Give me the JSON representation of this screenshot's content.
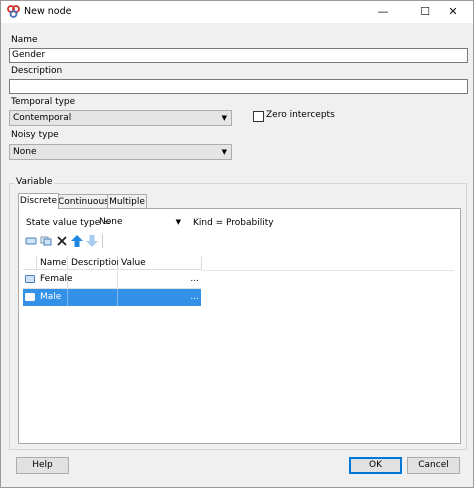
{
  "window": {
    "title": "New node",
    "minimize_glyph": "—",
    "maximize_glyph": "☐",
    "close_glyph": "✕"
  },
  "form": {
    "name_label": "Name",
    "name_value": "Gender",
    "description_label": "Description",
    "description_value": "",
    "temporal_label": "Temporal type",
    "temporal_value": "Contemporal",
    "zero_intercepts_label": "Zero intercepts",
    "zero_intercepts_checked": false,
    "noisy_label": "Noisy type",
    "noisy_value": "None"
  },
  "variable": {
    "group_label": "Variable",
    "tabs": [
      {
        "label": "Discrete",
        "active": true
      },
      {
        "label": "Continuous",
        "active": false
      },
      {
        "label": "Multiple",
        "active": false
      }
    ],
    "state_value_type_label": "State value type =",
    "state_value_type_value": "None",
    "kind_label": "Kind =",
    "kind_value": "Probability",
    "toolbar_icons": [
      "add-state-icon",
      "copy-state-icon",
      "delete-icon",
      "move-up-icon",
      "move-down-icon"
    ],
    "grid": {
      "columns": [
        "Name",
        "Description",
        "Value"
      ],
      "rows": [
        {
          "name": "Female",
          "description": "",
          "value": "",
          "ellipsis": "...",
          "selected": false
        },
        {
          "name": "Male",
          "description": "",
          "value": "",
          "ellipsis": "...",
          "selected": true
        }
      ]
    }
  },
  "buttons": {
    "help": "Help",
    "ok": "OK",
    "cancel": "Cancel"
  },
  "colors": {
    "selection": "#3391e8",
    "arrow_up": "#1e88e5",
    "arrow_down_disabled": "#a9cdef",
    "delete": "#222222"
  }
}
